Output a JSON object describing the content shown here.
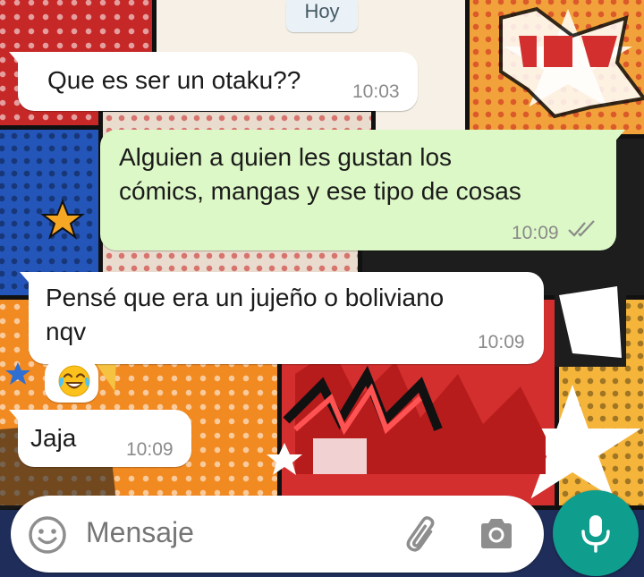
{
  "chat": {
    "date_label": "Hoy",
    "messages": [
      {
        "direction": "incoming",
        "text": "Que es ser un otaku??",
        "time": "10:03"
      },
      {
        "direction": "outgoing",
        "line1": "Alguien a quien les gustan los",
        "line2": "cómics, mangas y ese tipo de cosas",
        "time": "10:09",
        "status": "read"
      },
      {
        "direction": "incoming",
        "line1": "Pensé que era un jujeño o boliviano",
        "line2": "nqv",
        "time": "10:09"
      },
      {
        "direction": "incoming",
        "emoji": "face-with-tears-of-joy",
        "time": ""
      },
      {
        "direction": "incoming",
        "text": "Jaja",
        "time": "10:09"
      }
    ]
  },
  "composer": {
    "placeholder": "Mensaje",
    "icons": [
      "emoji-icon",
      "attach-icon",
      "camera-icon",
      "mic-icon"
    ]
  },
  "colors": {
    "incoming_bubble": "#ffffff",
    "outgoing_bubble": "#dcf8c6",
    "accent": "#0f9d8e",
    "read_ticks": "#8a8a8a"
  }
}
